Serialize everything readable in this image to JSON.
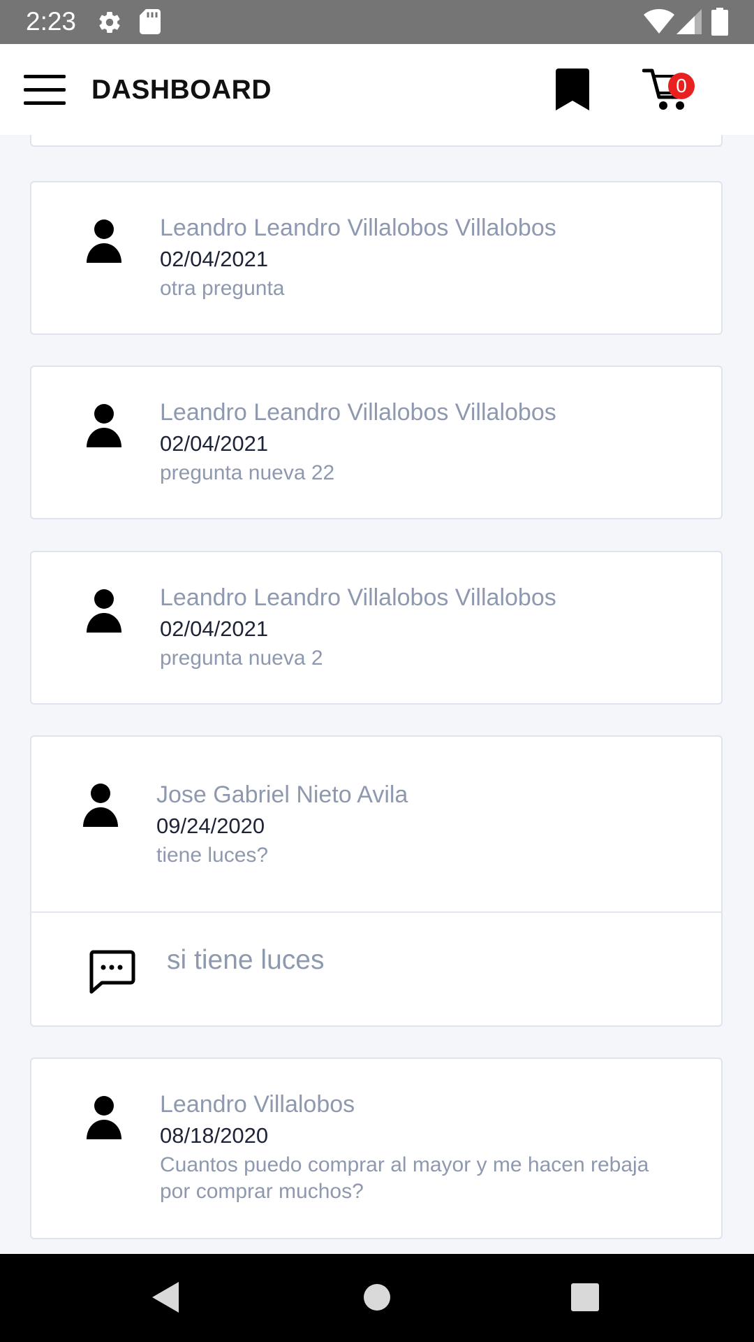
{
  "status_bar": {
    "time": "2:23",
    "icons": [
      "gear-icon",
      "sd-card-icon",
      "wifi-icon",
      "signal-icon",
      "battery-icon"
    ]
  },
  "app_bar": {
    "title": "DASHBOARD",
    "cart_count": "0"
  },
  "questions": [
    {
      "name": "Leandro Leandro Villalobos Villalobos",
      "date": "02/04/2021",
      "text": "otra pregunta"
    },
    {
      "name": "Leandro Leandro Villalobos Villalobos",
      "date": "02/04/2021",
      "text": "pregunta nueva 22"
    },
    {
      "name": "Leandro Leandro Villalobos Villalobos",
      "date": "02/04/2021",
      "text": "pregunta nueva 2"
    },
    {
      "name": "Jose Gabriel Nieto Avila",
      "date": "09/24/2020",
      "text": "tiene luces?",
      "answer": "si tiene luces"
    },
    {
      "name": "Leandro Villalobos",
      "date": "08/18/2020",
      "text": "Cuantos puedo comprar al mayor y me hacen rebaja por comprar muchos?"
    }
  ],
  "colors": {
    "status_bar": "#757575",
    "background": "#f5f6fa",
    "muted_text": "#8e98ae",
    "date_text": "#1e2437",
    "badge": "#e82020"
  }
}
